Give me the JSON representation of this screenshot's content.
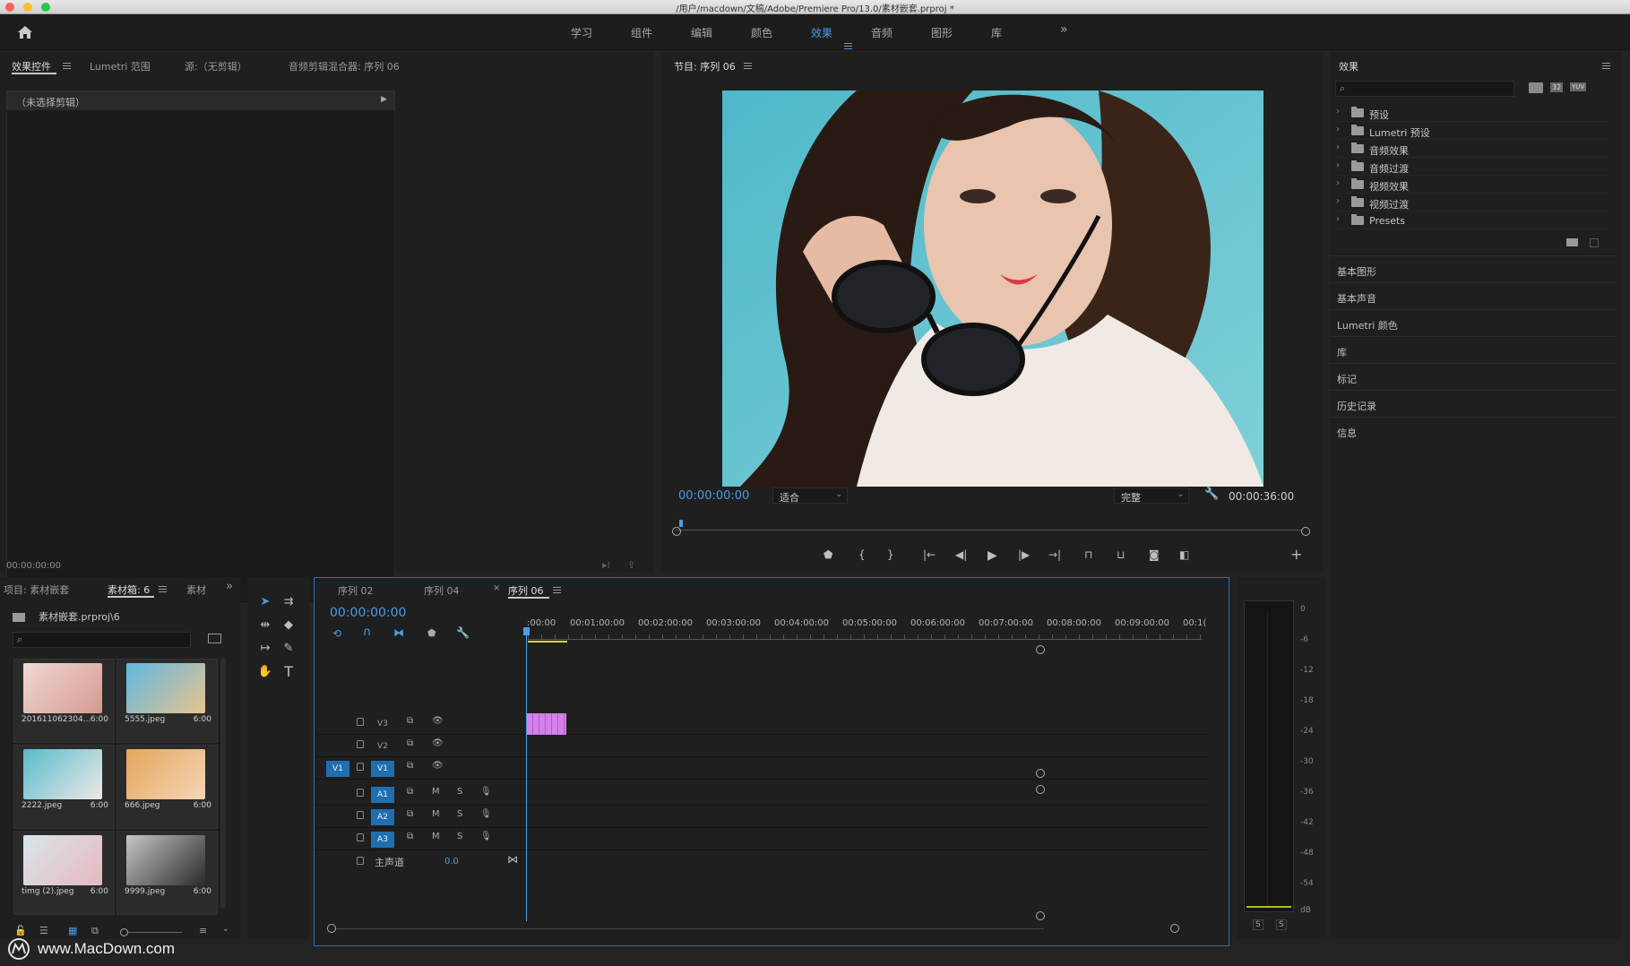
{
  "window": {
    "title": "/用户/macdown/文稿/Adobe/Premiere Pro/13.0/素材嵌套.prproj *"
  },
  "workspaces": {
    "items": [
      "学习",
      "组件",
      "编辑",
      "颜色",
      "效果",
      "音频",
      "图形",
      "库"
    ],
    "active": "效果",
    "overflow": "»"
  },
  "source_panel": {
    "tabs": [
      "效果控件",
      "Lumetri 范围",
      "源:（无剪辑）",
      "音频剪辑混合器: 序列 06"
    ],
    "no_clip": "（未选择剪辑）",
    "timecode": "00:00:00:00"
  },
  "program": {
    "title": "节目: 序列 06",
    "timecode": "00:00:00:00",
    "fit": "适合",
    "quality": "完整",
    "duration": "00:00:36:00"
  },
  "effects": {
    "title": "效果",
    "tree": [
      "预设",
      "Lumetri 预设",
      "音频效果",
      "音频过渡",
      "视频效果",
      "视频过渡",
      "Presets"
    ],
    "badges": [
      "32",
      "YUV"
    ],
    "sections": [
      "基本图形",
      "基本声音",
      "Lumetri 颜色",
      "库",
      "标记",
      "历史记录",
      "信息"
    ]
  },
  "project": {
    "tabs": [
      "项目: 素材嵌套",
      "素材箱: 6",
      "素材"
    ],
    "path": "素材嵌套.prproj\\6",
    "items": [
      {
        "name": "201611062304...",
        "dur": "6:00"
      },
      {
        "name": "5555.jpeg",
        "dur": "6:00"
      },
      {
        "name": "2222.jpeg",
        "dur": "6:00"
      },
      {
        "name": "666.jpeg",
        "dur": "6:00"
      },
      {
        "name": "timg (2).jpeg",
        "dur": "6:00"
      },
      {
        "name": "9999.jpeg",
        "dur": "6:00"
      }
    ]
  },
  "timeline": {
    "tabs": [
      "序列 02",
      "序列 04",
      "序列 06"
    ],
    "active_tab": "序列 06",
    "close": "×",
    "timecode": "00:00:00:00",
    "ruler": [
      ":00:00",
      "00:01:00:00",
      "00:02:00:00",
      "00:03:00:00",
      "00:04:00:00",
      "00:05:00:00",
      "00:06:00:00",
      "00:07:00:00",
      "00:08:00:00",
      "00:09:00:00",
      "00:1("
    ],
    "video_tracks": [
      "V3",
      "V2",
      "V1"
    ],
    "audio_tracks": [
      "A1",
      "A2",
      "A3"
    ],
    "source_patch": "V1",
    "mute": "M",
    "solo": "S",
    "master": {
      "label": "主声道",
      "value": "0.0"
    }
  },
  "meter": {
    "scale": [
      "0",
      "-6",
      "-12",
      "-18",
      "-24",
      "-30",
      "-36",
      "-42",
      "-48",
      "-54",
      "dB"
    ],
    "solo": [
      "S",
      "S"
    ]
  },
  "watermark": "www.MacDown.com",
  "colors": {
    "accent": "#4a9de8",
    "track_target": "#1f6fb0",
    "clip": "#d580e8"
  }
}
